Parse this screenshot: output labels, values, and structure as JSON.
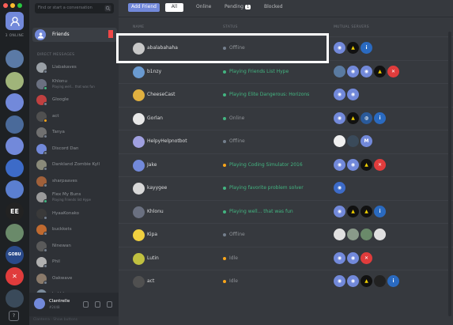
{
  "window": {
    "traffic_lights": [
      "#ff5f57",
      "#febc2e",
      "#28c840"
    ]
  },
  "rail": {
    "online_label": "3 ONLINE",
    "help_label": "?",
    "servers": [
      {
        "icon": "globe-icon",
        "color": "#5b7aa6",
        "text": ""
      },
      {
        "icon": "server-avatar",
        "color": "#a0b47a",
        "text": ""
      },
      {
        "icon": "discord-logo-icon",
        "color": "#7289da",
        "text": ""
      },
      {
        "icon": "server-avatar",
        "color": "#4a6a9a",
        "text": ""
      },
      {
        "icon": "discord-logo-icon",
        "color": "#7289da",
        "text": ""
      },
      {
        "icon": "server-avatar",
        "color": "#3d6bc8",
        "text": ""
      },
      {
        "icon": "server-avatar",
        "color": "#5b7fd0",
        "text": ""
      },
      {
        "icon": "server-avatar",
        "color": "#222222",
        "text": "EE"
      },
      {
        "icon": "server-avatar",
        "color": "#6a8a6a",
        "text": ""
      },
      {
        "icon": "server-avatar",
        "color": "#2a4a8a",
        "text": "GOBU"
      },
      {
        "icon": "crossed-tools-icon",
        "color": "#e03c3c",
        "text": "✕"
      },
      {
        "icon": "server-avatar",
        "color": "#3a4a5a",
        "text": ""
      }
    ]
  },
  "dmcol": {
    "search_placeholder": "Find or start a conversation",
    "friends_label": "Friends",
    "dm_header": "DIRECT MESSAGES",
    "dms": [
      {
        "name": "Llabakaves",
        "status": "",
        "color": "#9aa0a6",
        "dot": "#747f8d"
      },
      {
        "name": "Khlonu",
        "status": "Playing well... that was fun",
        "color": "#6a7080",
        "dot": "#43b581"
      },
      {
        "name": "Gloogle",
        "status": "",
        "color": "#c04040",
        "dot": "#747f8d"
      },
      {
        "name": "act",
        "status": "",
        "color": "#505050",
        "dot": "#faa61a"
      },
      {
        "name": "Tanya",
        "status": "",
        "color": "#707070",
        "dot": "#747f8d"
      },
      {
        "name": "Discord Dan",
        "status": "",
        "color": "#7289da",
        "dot": "#747f8d"
      },
      {
        "name": "Dankland Zombie Kyll",
        "status": "",
        "color": "#8a8a7a",
        "dot": "#747f8d"
      },
      {
        "name": "sharpaaves",
        "status": "",
        "color": "#a0603a",
        "dot": "#747f8d"
      },
      {
        "name": "Flex My Buns",
        "status": "Playing Friends list Hype",
        "color": "#9a9a9a",
        "dot": "#43b581"
      },
      {
        "name": "HyaaKonako",
        "status": "",
        "color": "#3a3a3a",
        "dot": "#747f8d"
      },
      {
        "name": "buckkets",
        "status": "",
        "color": "#c06a30",
        "dot": "#747f8d"
      },
      {
        "name": "Ninewan",
        "status": "",
        "color": "#5a5a5a",
        "dot": "#747f8d"
      },
      {
        "name": "Phil",
        "status": "",
        "color": "#b0b0b0",
        "dot": "#747f8d"
      },
      {
        "name": "Oakwave",
        "status": "",
        "color": "#8a7a6a",
        "dot": "#747f8d"
      },
      {
        "name": "kahbhs",
        "status": "",
        "color": "#7a8a9a",
        "dot": "#747f8d"
      }
    ],
    "user": {
      "name": "Clantrelle",
      "discriminator": "#2448"
    },
    "footer": "Clanterra · Show buttons"
  },
  "main": {
    "tabs": {
      "add_friend": "Add Friend",
      "all": "All",
      "online": "Online",
      "pending": "Pending",
      "pending_count": "1",
      "blocked": "Blocked"
    },
    "columns": {
      "name": "NAME",
      "status": "STATUS",
      "mutual": "MUTUAL SERVERS"
    },
    "friends": [
      {
        "name": "abalabahaha",
        "status": "Offline",
        "kind": "offline",
        "avatar": "#c8c8c8",
        "servers": [
          {
            "c": "#7289da",
            "i": "discord-logo-icon",
            "t": "◉"
          },
          {
            "c": "#111111",
            "i": "triangle-icon",
            "t": "▲"
          },
          {
            "c": "#2a6ac0",
            "i": "info-icon",
            "t": "i"
          }
        ]
      },
      {
        "name": "b1nzy",
        "status": "Playing Friends List Hype",
        "kind": "playing",
        "avatar": "#6a9ad0",
        "servers": [
          {
            "c": "#5a7aa0",
            "i": "globe-icon",
            "t": ""
          },
          {
            "c": "#7289da",
            "i": "discord-logo-icon",
            "t": "◉"
          },
          {
            "c": "#7289da",
            "i": "discord-logo-icon",
            "t": "◉"
          },
          {
            "c": "#111111",
            "i": "triangle-icon",
            "t": "▲"
          },
          {
            "c": "#e03c3c",
            "i": "crossed-tools-icon",
            "t": "✕"
          }
        ]
      },
      {
        "name": "CheeseCast",
        "status": "Playing Elite Dangerous: Horizons",
        "kind": "playing",
        "avatar": "#e0b040",
        "servers": [
          {
            "c": "#7289da",
            "i": "discord-logo-icon",
            "t": "◉"
          },
          {
            "c": "#7289da",
            "i": "discord-logo-icon",
            "t": "◉"
          }
        ]
      },
      {
        "name": "Gorlan",
        "status": "Online",
        "kind": "online",
        "avatar": "#e8e8e8",
        "servers": [
          {
            "c": "#7289da",
            "i": "discord-logo-icon",
            "t": "◉"
          },
          {
            "c": "#111111",
            "i": "triangle-icon",
            "t": "▲"
          },
          {
            "c": "#2a5a9a",
            "i": "globe-icon",
            "t": "◍"
          },
          {
            "c": "#2a6ac0",
            "i": "info-icon",
            "t": "i"
          }
        ]
      },
      {
        "name": "HelpyHelpnotbot",
        "status": "Offline",
        "kind": "offline",
        "avatar": "#a0a0e0",
        "servers": [
          {
            "c": "#f0f0f0",
            "i": "cloud-icon",
            "t": ""
          },
          {
            "c": "#3a4a5a",
            "i": "server-avatar",
            "t": ""
          },
          {
            "c": "#7289da",
            "i": "letter-m-icon",
            "t": "M"
          }
        ]
      },
      {
        "name": "Jake",
        "status": "Playing Coding Simulator 2016",
        "kind": "idle",
        "avatar": "#7289da",
        "servers": [
          {
            "c": "#7289da",
            "i": "discord-logo-icon",
            "t": "◉"
          },
          {
            "c": "#7289da",
            "i": "discord-logo-icon",
            "t": "◉"
          },
          {
            "c": "#111111",
            "i": "triangle-icon",
            "t": "▲"
          },
          {
            "c": "#e03c3c",
            "i": "crossed-tools-icon",
            "t": "✕"
          }
        ]
      },
      {
        "name": "kayygee",
        "status": "Playing favorite problem solver",
        "kind": "playing",
        "avatar": "#d8d8d8",
        "servers": [
          {
            "c": "#3d6bc8",
            "i": "server-avatar",
            "t": "◉"
          }
        ]
      },
      {
        "name": "Khlonu",
        "status": "Playing well... that was fun",
        "kind": "playing",
        "avatar": "#6a7080",
        "servers": [
          {
            "c": "#7289da",
            "i": "discord-logo-icon",
            "t": "◉"
          },
          {
            "c": "#111111",
            "i": "triangle-icon",
            "t": "▲"
          },
          {
            "c": "#111111",
            "i": "triangle-icon",
            "t": "▲"
          },
          {
            "c": "#2a6ac0",
            "i": "info-icon",
            "t": "i"
          }
        ]
      },
      {
        "name": "Kipa",
        "status": "Offline",
        "kind": "offline",
        "avatar": "#f0d040",
        "servers": [
          {
            "c": "#e0e0e0",
            "i": "cloud-icon",
            "t": ""
          },
          {
            "c": "#8a9a8a",
            "i": "server-avatar",
            "t": ""
          },
          {
            "c": "#6a8a6a",
            "i": "server-avatar",
            "t": ""
          },
          {
            "c": "#e0e0e0",
            "i": "leaf-icon",
            "t": ""
          }
        ]
      },
      {
        "name": "Lutin",
        "status": "Idle",
        "kind": "idle",
        "avatar": "#c0c040",
        "servers": [
          {
            "c": "#7289da",
            "i": "discord-logo-icon",
            "t": "◉"
          },
          {
            "c": "#7289da",
            "i": "discord-logo-icon",
            "t": "◉"
          },
          {
            "c": "#e03c3c",
            "i": "crossed-tools-icon",
            "t": "✕"
          }
        ]
      },
      {
        "name": "act",
        "status": "Idle",
        "kind": "idle",
        "avatar": "#505050",
        "servers": [
          {
            "c": "#7289da",
            "i": "discord-logo-icon",
            "t": "◉"
          },
          {
            "c": "#7289da",
            "i": "discord-logo-icon",
            "t": "◉"
          },
          {
            "c": "#111111",
            "i": "triangle-icon",
            "t": "▲"
          },
          {
            "c": "#222222",
            "i": "server-avatar",
            "t": ""
          },
          {
            "c": "#2a6ac0",
            "i": "info-icon",
            "t": "i"
          }
        ]
      }
    ]
  },
  "colors": {
    "online": "#43b581",
    "idle": "#faa61a",
    "offline": "#747f8d",
    "accent": "#7289da"
  }
}
